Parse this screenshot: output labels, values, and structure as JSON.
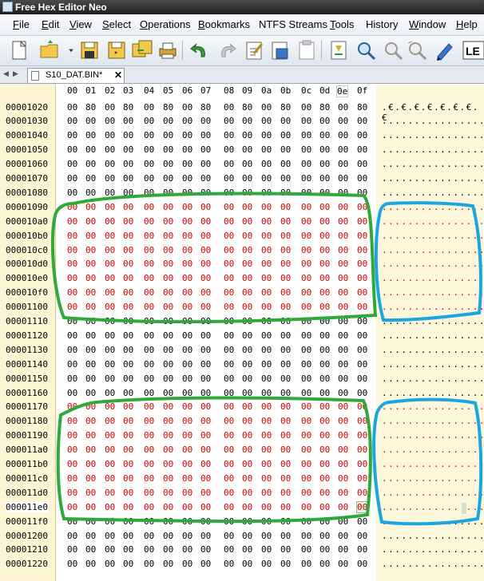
{
  "window": {
    "title": "Free Hex Editor Neo"
  },
  "menu": [
    {
      "label": "File",
      "ul": "F",
      "rest": "ile"
    },
    {
      "label": "Edit",
      "ul": "E",
      "rest": "dit"
    },
    {
      "label": "View",
      "ul": "V",
      "rest": "iew"
    },
    {
      "label": "Select",
      "ul": "S",
      "rest": "elect"
    },
    {
      "label": "Operations",
      "ul": "O",
      "rest": "perations"
    },
    {
      "label": "Bookmarks",
      "ul": "B",
      "rest": "ookmarks"
    },
    {
      "label": "NTFS Streams",
      "ul": "",
      "rest": "NTFS Streams"
    },
    {
      "label": "Tools",
      "ul": "T",
      "rest": "ools"
    },
    {
      "label": "History",
      "ul": "",
      "rest": "History"
    },
    {
      "label": "Window",
      "ul": "W",
      "rest": "indow"
    },
    {
      "label": "Help",
      "ul": "H",
      "rest": "elp"
    }
  ],
  "toolbar": [
    {
      "name": "new-file-icon"
    },
    {
      "name": "open-folder-icon"
    },
    {
      "name": "open-dropdown-icon"
    },
    {
      "name": "save-icon"
    },
    {
      "name": "save-as-icon"
    },
    {
      "name": "save-all-icon"
    },
    {
      "name": "print-icon"
    },
    {
      "name": "undo-icon"
    },
    {
      "name": "redo-icon"
    },
    {
      "name": "edit-clipboard-icon"
    },
    {
      "name": "copy-clipboard-icon"
    },
    {
      "name": "paste-clipboard-icon"
    },
    {
      "name": "bookmark-down-icon"
    },
    {
      "name": "find-icon"
    },
    {
      "name": "find-next-icon"
    },
    {
      "name": "find-replace-icon"
    },
    {
      "name": "edit-pen-icon"
    },
    {
      "name": "le-encoding-icon"
    }
  ],
  "tab": {
    "label": "S10_DAT.BIN*",
    "close": "✕"
  },
  "tab_nav": {
    "prev": "◀",
    "next": "▶"
  },
  "column_headers": [
    "00",
    "01",
    "02",
    "03",
    "04",
    "05",
    "06",
    "07",
    "08",
    "09",
    "0a",
    "0b",
    "0c",
    "0d",
    "0e",
    "0f"
  ],
  "active_column": "0e",
  "rows": [
    {
      "addr": "00001020",
      "hl": false,
      "bytes": [
        "00",
        "80",
        "00",
        "80",
        "00",
        "80",
        "00",
        "80",
        "00",
        "80",
        "00",
        "80",
        "00",
        "80",
        "00",
        "80"
      ],
      "ascii": ".€.€.€.€.€.€.€.€"
    },
    {
      "addr": "00001030",
      "hl": false,
      "bytes": [
        "00",
        "00",
        "00",
        "00",
        "00",
        "00",
        "00",
        "00",
        "00",
        "00",
        "00",
        "00",
        "00",
        "00",
        "00",
        "00"
      ],
      "ascii": "................"
    },
    {
      "addr": "00001040",
      "hl": false,
      "bytes": [
        "00",
        "00",
        "00",
        "00",
        "00",
        "00",
        "00",
        "00",
        "00",
        "00",
        "00",
        "00",
        "00",
        "00",
        "00",
        "00"
      ],
      "ascii": "................"
    },
    {
      "addr": "00001050",
      "hl": false,
      "bytes": [
        "00",
        "00",
        "00",
        "00",
        "00",
        "00",
        "00",
        "00",
        "00",
        "00",
        "00",
        "00",
        "00",
        "00",
        "00",
        "00"
      ],
      "ascii": "................"
    },
    {
      "addr": "00001060",
      "hl": false,
      "bytes": [
        "00",
        "00",
        "00",
        "00",
        "00",
        "00",
        "00",
        "00",
        "00",
        "00",
        "00",
        "00",
        "00",
        "00",
        "00",
        "00"
      ],
      "ascii": "................"
    },
    {
      "addr": "00001070",
      "hl": false,
      "bytes": [
        "00",
        "00",
        "00",
        "00",
        "00",
        "00",
        "00",
        "00",
        "00",
        "00",
        "00",
        "00",
        "00",
        "00",
        "00",
        "00"
      ],
      "ascii": "................"
    },
    {
      "addr": "00001080",
      "hl": false,
      "bytes": [
        "00",
        "00",
        "00",
        "00",
        "00",
        "00",
        "00",
        "00",
        "00",
        "00",
        "00",
        "00",
        "00",
        "00",
        "00",
        "00"
      ],
      "ascii": "................"
    },
    {
      "addr": "00001090",
      "hl": true,
      "bytes": [
        "00",
        "00",
        "00",
        "00",
        "00",
        "00",
        "00",
        "00",
        "00",
        "00",
        "00",
        "00",
        "00",
        "00",
        "00",
        "00"
      ],
      "ascii": "................"
    },
    {
      "addr": "000010a0",
      "hl": true,
      "bytes": [
        "00",
        "00",
        "00",
        "00",
        "00",
        "00",
        "00",
        "00",
        "00",
        "00",
        "00",
        "00",
        "00",
        "00",
        "00",
        "00"
      ],
      "ascii": "................"
    },
    {
      "addr": "000010b0",
      "hl": true,
      "bytes": [
        "00",
        "00",
        "00",
        "00",
        "00",
        "00",
        "00",
        "00",
        "00",
        "00",
        "00",
        "00",
        "00",
        "00",
        "00",
        "00"
      ],
      "ascii": "................"
    },
    {
      "addr": "000010c0",
      "hl": true,
      "bytes": [
        "00",
        "00",
        "00",
        "00",
        "00",
        "00",
        "00",
        "00",
        "00",
        "00",
        "00",
        "00",
        "00",
        "00",
        "00",
        "00"
      ],
      "ascii": "................"
    },
    {
      "addr": "000010d0",
      "hl": true,
      "bytes": [
        "00",
        "00",
        "00",
        "00",
        "00",
        "00",
        "00",
        "00",
        "00",
        "00",
        "00",
        "00",
        "00",
        "00",
        "00",
        "00"
      ],
      "ascii": "................"
    },
    {
      "addr": "000010e0",
      "hl": true,
      "bytes": [
        "00",
        "00",
        "00",
        "00",
        "00",
        "00",
        "00",
        "00",
        "00",
        "00",
        "00",
        "00",
        "00",
        "00",
        "00",
        "00"
      ],
      "ascii": "................"
    },
    {
      "addr": "000010f0",
      "hl": true,
      "bytes": [
        "00",
        "00",
        "00",
        "00",
        "00",
        "00",
        "00",
        "00",
        "00",
        "00",
        "00",
        "00",
        "00",
        "00",
        "00",
        "00"
      ],
      "ascii": "................"
    },
    {
      "addr": "00001100",
      "hl": true,
      "bytes": [
        "00",
        "00",
        "00",
        "00",
        "00",
        "00",
        "00",
        "00",
        "00",
        "00",
        "00",
        "00",
        "00",
        "00",
        "00",
        "00"
      ],
      "ascii": "................"
    },
    {
      "addr": "00001110",
      "hl": false,
      "bytes": [
        "00",
        "00",
        "00",
        "00",
        "00",
        "00",
        "00",
        "00",
        "00",
        "00",
        "00",
        "00",
        "00",
        "00",
        "00",
        "00"
      ],
      "ascii": "................"
    },
    {
      "addr": "00001120",
      "hl": false,
      "bytes": [
        "00",
        "00",
        "00",
        "00",
        "00",
        "00",
        "00",
        "00",
        "00",
        "00",
        "00",
        "00",
        "00",
        "00",
        "00",
        "00"
      ],
      "ascii": "................"
    },
    {
      "addr": "00001130",
      "hl": false,
      "bytes": [
        "00",
        "00",
        "00",
        "00",
        "00",
        "00",
        "00",
        "00",
        "00",
        "00",
        "00",
        "00",
        "00",
        "00",
        "00",
        "00"
      ],
      "ascii": "................"
    },
    {
      "addr": "00001140",
      "hl": false,
      "bytes": [
        "00",
        "00",
        "00",
        "00",
        "00",
        "00",
        "00",
        "00",
        "00",
        "00",
        "00",
        "00",
        "00",
        "00",
        "00",
        "00"
      ],
      "ascii": "................"
    },
    {
      "addr": "00001150",
      "hl": false,
      "bytes": [
        "00",
        "00",
        "00",
        "00",
        "00",
        "00",
        "00",
        "00",
        "00",
        "00",
        "00",
        "00",
        "00",
        "00",
        "00",
        "00"
      ],
      "ascii": "................"
    },
    {
      "addr": "00001160",
      "hl": false,
      "bytes": [
        "00",
        "00",
        "00",
        "00",
        "00",
        "00",
        "00",
        "00",
        "00",
        "00",
        "00",
        "00",
        "00",
        "00",
        "00",
        "00"
      ],
      "ascii": "................"
    },
    {
      "addr": "00001170",
      "hl": true,
      "bytes": [
        "00",
        "00",
        "00",
        "00",
        "00",
        "00",
        "00",
        "00",
        "00",
        "00",
        "00",
        "00",
        "00",
        "00",
        "00",
        "00"
      ],
      "ascii": "................"
    },
    {
      "addr": "00001180",
      "hl": true,
      "bytes": [
        "00",
        "00",
        "00",
        "00",
        "00",
        "00",
        "00",
        "00",
        "00",
        "00",
        "00",
        "00",
        "00",
        "00",
        "00",
        "00"
      ],
      "ascii": "................"
    },
    {
      "addr": "00001190",
      "hl": true,
      "bytes": [
        "00",
        "00",
        "00",
        "00",
        "00",
        "00",
        "00",
        "00",
        "00",
        "00",
        "00",
        "00",
        "00",
        "00",
        "00",
        "00"
      ],
      "ascii": "................"
    },
    {
      "addr": "000011a0",
      "hl": true,
      "bytes": [
        "00",
        "00",
        "00",
        "00",
        "00",
        "00",
        "00",
        "00",
        "00",
        "00",
        "00",
        "00",
        "00",
        "00",
        "00",
        "00"
      ],
      "ascii": "................"
    },
    {
      "addr": "000011b0",
      "hl": true,
      "bytes": [
        "00",
        "00",
        "00",
        "00",
        "00",
        "00",
        "00",
        "00",
        "00",
        "00",
        "00",
        "00",
        "00",
        "00",
        "00",
        "00"
      ],
      "ascii": "................"
    },
    {
      "addr": "000011c0",
      "hl": true,
      "bytes": [
        "00",
        "00",
        "00",
        "00",
        "00",
        "00",
        "00",
        "00",
        "00",
        "00",
        "00",
        "00",
        "00",
        "00",
        "00",
        "00"
      ],
      "ascii": "................"
    },
    {
      "addr": "000011d0",
      "hl": true,
      "bytes": [
        "00",
        "00",
        "00",
        "00",
        "00",
        "00",
        "00",
        "00",
        "00",
        "00",
        "00",
        "00",
        "00",
        "00",
        "00",
        "00"
      ],
      "ascii": "................"
    },
    {
      "addr": "000011e0",
      "hl": true,
      "current": true,
      "bytes": [
        "00",
        "00",
        "00",
        "00",
        "00",
        "00",
        "00",
        "00",
        "00",
        "00",
        "00",
        "00",
        "00",
        "00",
        "00",
        "00"
      ],
      "ascii": "................"
    },
    {
      "addr": "000011f0",
      "hl": false,
      "bytes": [
        "00",
        "00",
        "00",
        "00",
        "00",
        "00",
        "00",
        "00",
        "00",
        "00",
        "00",
        "00",
        "00",
        "00",
        "00",
        "00"
      ],
      "ascii": "................"
    },
    {
      "addr": "00001200",
      "hl": false,
      "bytes": [
        "00",
        "00",
        "00",
        "00",
        "00",
        "00",
        "00",
        "00",
        "00",
        "00",
        "00",
        "00",
        "00",
        "00",
        "00",
        "00"
      ],
      "ascii": "................"
    },
    {
      "addr": "00001210",
      "hl": false,
      "bytes": [
        "00",
        "00",
        "00",
        "00",
        "00",
        "00",
        "00",
        "00",
        "00",
        "00",
        "00",
        "00",
        "00",
        "00",
        "00",
        "00"
      ],
      "ascii": "................"
    },
    {
      "addr": "00001220",
      "hl": false,
      "bytes": [
        "00",
        "00",
        "00",
        "00",
        "00",
        "00",
        "00",
        "00",
        "00",
        "00",
        "00",
        "00",
        "00",
        "00",
        "00",
        "00"
      ],
      "ascii": "................"
    }
  ],
  "colors": {
    "highlight_text": "#d00000",
    "annotation_green": "#2faa3a",
    "annotation_blue": "#1aa6e0",
    "gutter_bg": "#fdf5d4",
    "ascii_bg": "#fdf7dc"
  }
}
